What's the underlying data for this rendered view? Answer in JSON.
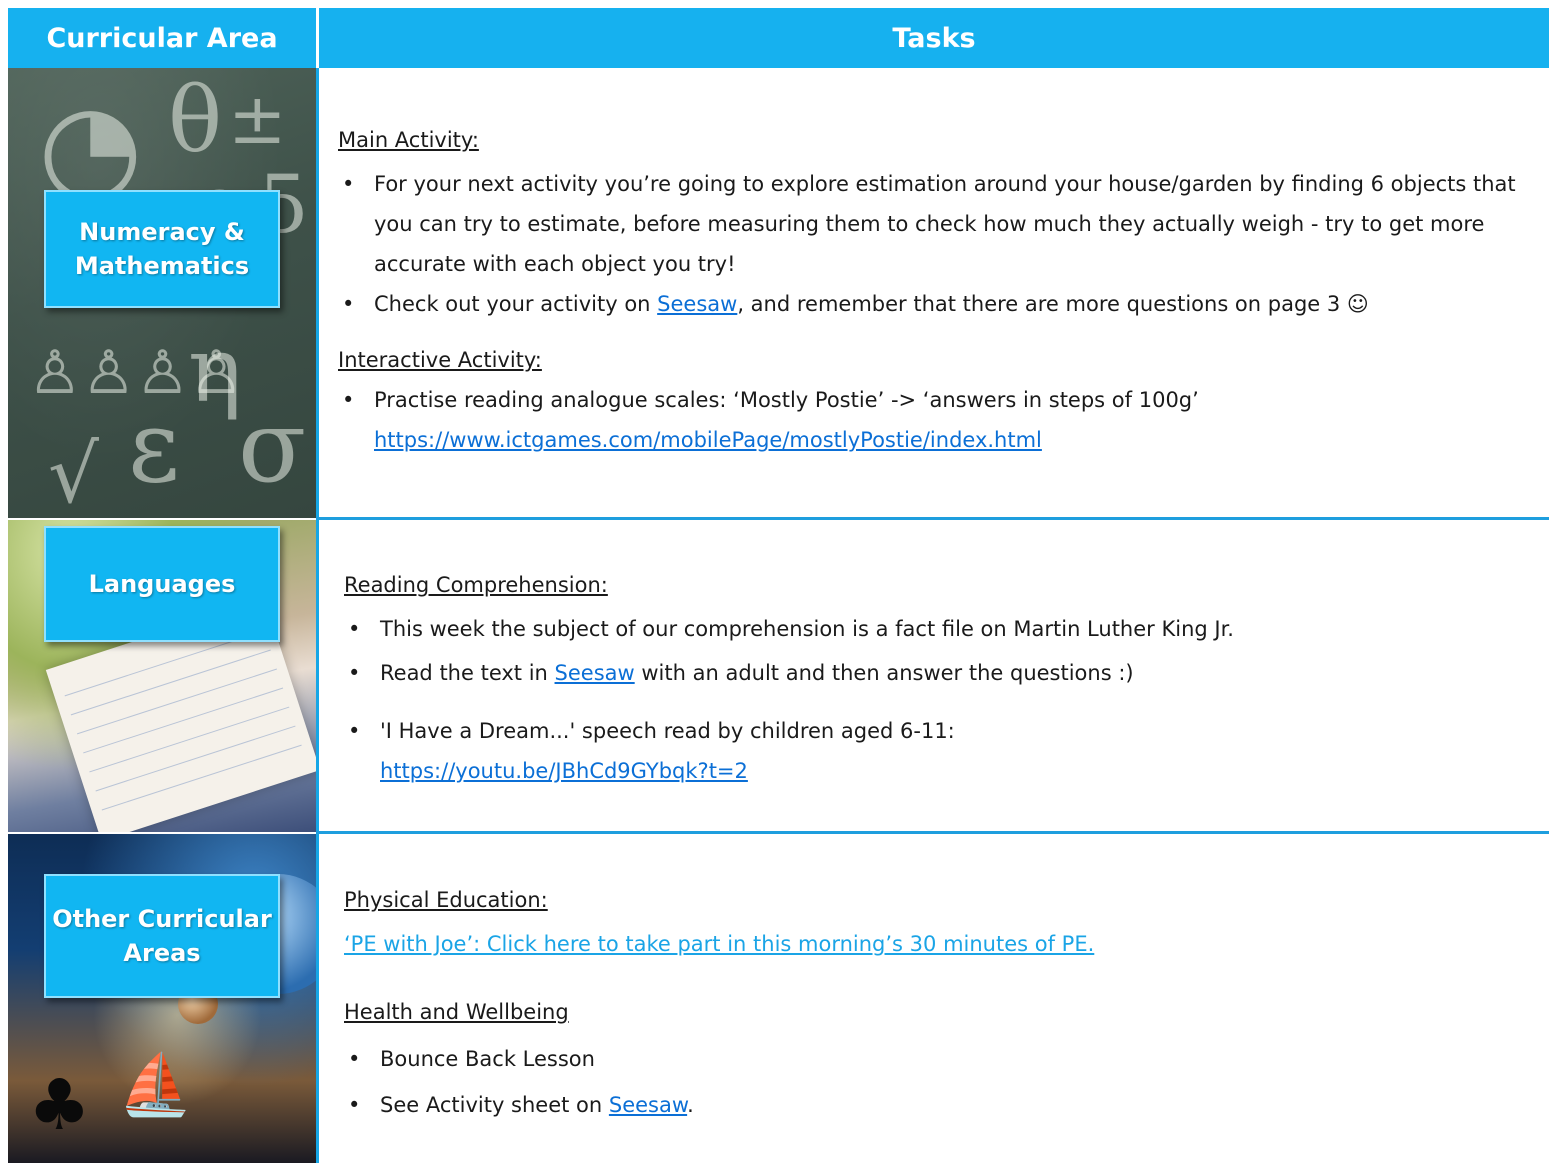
{
  "header": {
    "left": "Curricular Area",
    "right": "Tasks"
  },
  "rows": [
    {
      "area": "Numeracy & Mathematics",
      "main_activity_heading": "Main Activity:",
      "bullet1": "For your next activity you’re going to explore estimation around your house/garden by finding 6 objects that you can try to estimate, before measuring them to check how much they actually weigh - try to get more accurate with each object you try!",
      "bullet2_pre": "Check out your activity on ",
      "bullet2_link": "Seesaw",
      "bullet2_post": ", and remember that there are more questions on page 3 ☺",
      "interactive_heading": "Interactive Activity:",
      "bullet3": "Practise reading analogue scales: ‘Mostly Postie’ -> ‘answers in steps of 100g’",
      "bullet3_link": "https://www.ictgames.com/mobilePage/mostlyPostie/index.html"
    },
    {
      "area": "Languages",
      "heading": "Reading Comprehension:",
      "bullet1": "This week the subject of our comprehension is a fact file on Martin Luther King Jr.",
      "bullet2_pre": "Read the text in ",
      "bullet2_link": "Seesaw",
      "bullet2_post": " with an adult and then answer the questions :)",
      "bullet3": "'I Have a Dream...' speech read by children aged 6-11:",
      "bullet3_link": "https://youtu.be/JBhCd9GYbqk?t=2"
    },
    {
      "area": "Other Curricular Areas",
      "pe_heading": "Physical Education:",
      "pe_link": "‘PE with Joe’: Click here to take part in this morning’s 30 minutes of PE.",
      "hw_heading": "Health and Wellbeing",
      "bullet1": "Bounce Back Lesson",
      "bullet2_pre": "See Activity sheet on ",
      "bullet2_link": "Seesaw",
      "bullet2_post": "."
    }
  ],
  "colors": {
    "header": "#16b1ef",
    "badge": "#11b6f2",
    "link": "#0b6fd6",
    "divider": "#1e9ede"
  }
}
